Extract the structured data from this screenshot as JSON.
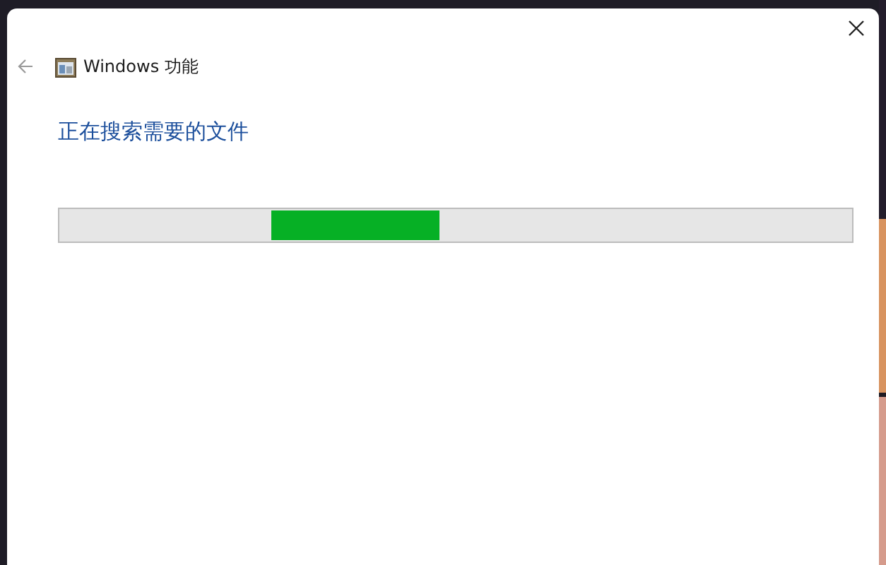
{
  "window": {
    "title": "Windows 功能"
  },
  "heading": "正在搜索需要的文件",
  "progress": {
    "kind": "indeterminate"
  }
}
